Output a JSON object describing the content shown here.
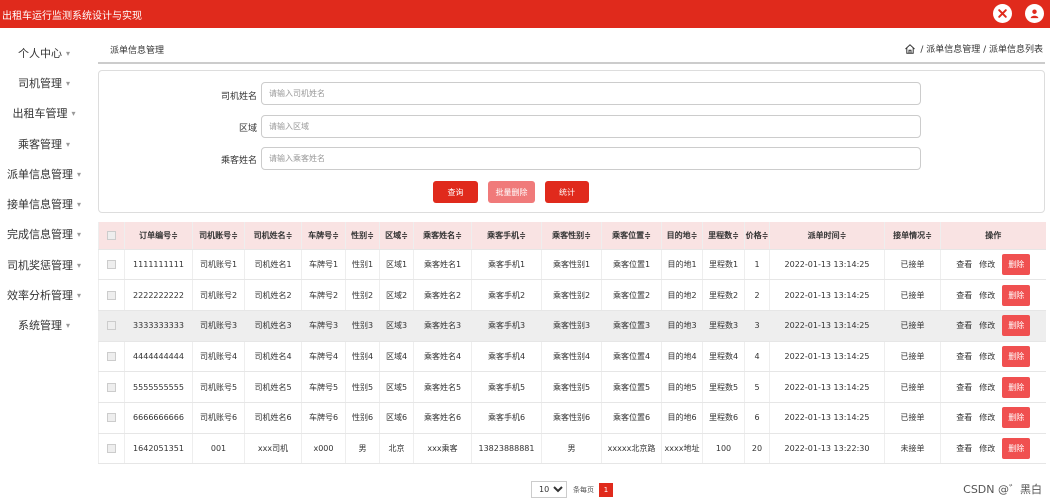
{
  "app": {
    "title": "出租车运行监测系统设计与实现"
  },
  "colors": {
    "accent": "#e02a1c",
    "header_row": "#f9e3e3"
  },
  "top_icons": [
    "close-icon",
    "user-icon"
  ],
  "sidebar": {
    "items": [
      {
        "label": "个人中心"
      },
      {
        "label": "司机管理"
      },
      {
        "label": "出租车管理"
      },
      {
        "label": "乘客管理"
      },
      {
        "label": "派单信息管理"
      },
      {
        "label": "接单信息管理"
      },
      {
        "label": "完成信息管理"
      },
      {
        "label": "司机奖惩管理"
      },
      {
        "label": "效率分析管理"
      },
      {
        "label": "系统管理"
      }
    ]
  },
  "breadcrumb": {
    "title": "派单信息管理",
    "path": "/ 派单信息管理 / 派单信息列表"
  },
  "search": {
    "fields": [
      {
        "label": "司机姓名",
        "placeholder": "请输入司机姓名",
        "value": ""
      },
      {
        "label": "区域",
        "placeholder": "请输入区域",
        "value": ""
      },
      {
        "label": "乘客姓名",
        "placeholder": "请输入乘客姓名",
        "value": ""
      }
    ],
    "buttons": {
      "query": "查询",
      "batch_delete": "批量删除",
      "stats": "统计"
    }
  },
  "table": {
    "columns": [
      "订单编号≑",
      "司机账号≑",
      "司机姓名≑",
      "车牌号≑",
      "性别≑",
      "区域≑",
      "乘客姓名≑",
      "乘客手机≑",
      "乘客性别≑",
      "乘客位置≑",
      "目的地≑",
      "里程数≑",
      "价格≑",
      "派单时间≑",
      "接单情况≑",
      "操作"
    ],
    "rows": [
      [
        "1111111111",
        "司机账号1",
        "司机姓名1",
        "车牌号1",
        "性别1",
        "区域1",
        "乘客姓名1",
        "乘客手机1",
        "乘客性别1",
        "乘客位置1",
        "目的地1",
        "里程数1",
        "1",
        "2022-01-13 13:14:25",
        "已接单"
      ],
      [
        "2222222222",
        "司机账号2",
        "司机姓名2",
        "车牌号2",
        "性别2",
        "区域2",
        "乘客姓名2",
        "乘客手机2",
        "乘客性别2",
        "乘客位置2",
        "目的地2",
        "里程数2",
        "2",
        "2022-01-13 13:14:25",
        "已接单"
      ],
      [
        "3333333333",
        "司机账号3",
        "司机姓名3",
        "车牌号3",
        "性别3",
        "区域3",
        "乘客姓名3",
        "乘客手机3",
        "乘客性别3",
        "乘客位置3",
        "目的地3",
        "里程数3",
        "3",
        "2022-01-13 13:14:25",
        "已接单"
      ],
      [
        "4444444444",
        "司机账号4",
        "司机姓名4",
        "车牌号4",
        "性别4",
        "区域4",
        "乘客姓名4",
        "乘客手机4",
        "乘客性别4",
        "乘客位置4",
        "目的地4",
        "里程数4",
        "4",
        "2022-01-13 13:14:25",
        "已接单"
      ],
      [
        "5555555555",
        "司机账号5",
        "司机姓名5",
        "车牌号5",
        "性别5",
        "区域5",
        "乘客姓名5",
        "乘客手机5",
        "乘客性别5",
        "乘客位置5",
        "目的地5",
        "里程数5",
        "5",
        "2022-01-13 13:14:25",
        "已接单"
      ],
      [
        "6666666666",
        "司机账号6",
        "司机姓名6",
        "车牌号6",
        "性别6",
        "区域6",
        "乘客姓名6",
        "乘客手机6",
        "乘客性别6",
        "乘客位置6",
        "目的地6",
        "里程数6",
        "6",
        "2022-01-13 13:14:25",
        "已接单"
      ],
      [
        "1642051351",
        "001",
        "xxx司机",
        "x000",
        "男",
        "北京",
        "xxx乘客",
        "13823888881",
        "男",
        "xxxxx北京路",
        "xxxx地址",
        "100",
        "20",
        "2022-01-13 13:22:30",
        "未接单"
      ]
    ],
    "actions": {
      "view": "查看",
      "edit": "修改",
      "delete": "删除"
    }
  },
  "pager": {
    "page_size": "10",
    "size_options": [
      "10"
    ],
    "per_page_label": "条每页",
    "current_page": "1"
  },
  "watermark": "CSDN @゛黑白"
}
